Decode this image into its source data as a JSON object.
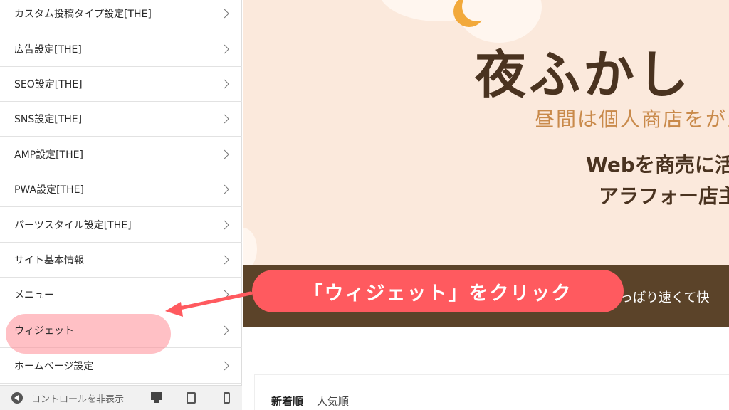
{
  "sidebar": {
    "items": [
      {
        "label": "カスタム投稿タイプ設定[THE]"
      },
      {
        "label": "広告設定[THE]"
      },
      {
        "label": "SEO設定[THE]"
      },
      {
        "label": "SNS設定[THE]"
      },
      {
        "label": "AMP設定[THE]"
      },
      {
        "label": "PWA設定[THE]"
      },
      {
        "label": "パーツスタイル設定[THE]"
      },
      {
        "label": "サイト基本情報"
      },
      {
        "label": "メニュー"
      },
      {
        "label": "ウィジェット"
      },
      {
        "label": "ホームページ設定"
      }
    ],
    "footer": {
      "collapse_label": "コントロールを非表示"
    }
  },
  "preview": {
    "site_title": "夜ふかし",
    "tagline": "昼間は個人商店をがん",
    "description_line1": "Webを商売に活",
    "description_line2": "アラフォー店主",
    "band_text": "っぱり速くて快",
    "tabs": [
      "新着順",
      "人気順"
    ]
  },
  "annotation": {
    "callout_text": "「ウィジェット」をクリック",
    "highlight_color": "#ff5a5f"
  },
  "colors": {
    "hero_bg": "#fbe9dc",
    "band_bg": "#5b4329",
    "title_color": "#4a3320",
    "accent_moon": "#f2a93b"
  }
}
